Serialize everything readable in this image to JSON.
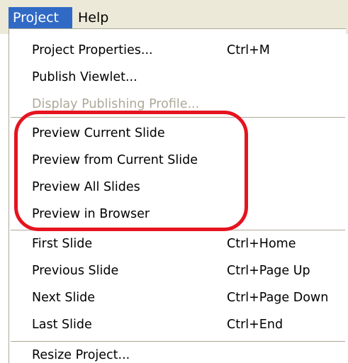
{
  "menubar": {
    "items": [
      {
        "label": "Project",
        "active": true
      },
      {
        "label": "Help",
        "active": false
      }
    ]
  },
  "menu": {
    "groups": [
      [
        {
          "label": "Project Properties...",
          "shortcut": "Ctrl+M",
          "enabled": true
        },
        {
          "label": "Publish Viewlet...",
          "shortcut": "",
          "enabled": true
        },
        {
          "label": "Display Publishing Profile...",
          "shortcut": "",
          "enabled": false
        }
      ],
      [
        {
          "label": "Preview Current Slide",
          "shortcut": "",
          "enabled": true
        },
        {
          "label": "Preview from Current Slide",
          "shortcut": "",
          "enabled": true
        },
        {
          "label": "Preview All Slides",
          "shortcut": "",
          "enabled": true
        },
        {
          "label": "Preview in Browser",
          "shortcut": "",
          "enabled": true
        }
      ],
      [
        {
          "label": "First Slide",
          "shortcut": "Ctrl+Home",
          "enabled": true
        },
        {
          "label": "Previous Slide",
          "shortcut": "Ctrl+Page Up",
          "enabled": true
        },
        {
          "label": "Next Slide",
          "shortcut": "Ctrl+Page Down",
          "enabled": true
        },
        {
          "label": "Last Slide",
          "shortcut": "Ctrl+End",
          "enabled": true
        }
      ],
      [
        {
          "label": "Resize Project...",
          "shortcut": "",
          "enabled": true
        }
      ]
    ]
  },
  "colors": {
    "menubar_bg": "#ece9d8",
    "selection_bg": "#316ac5",
    "disabled_text": "#aca899",
    "annotation_ring": "#e5141e"
  }
}
